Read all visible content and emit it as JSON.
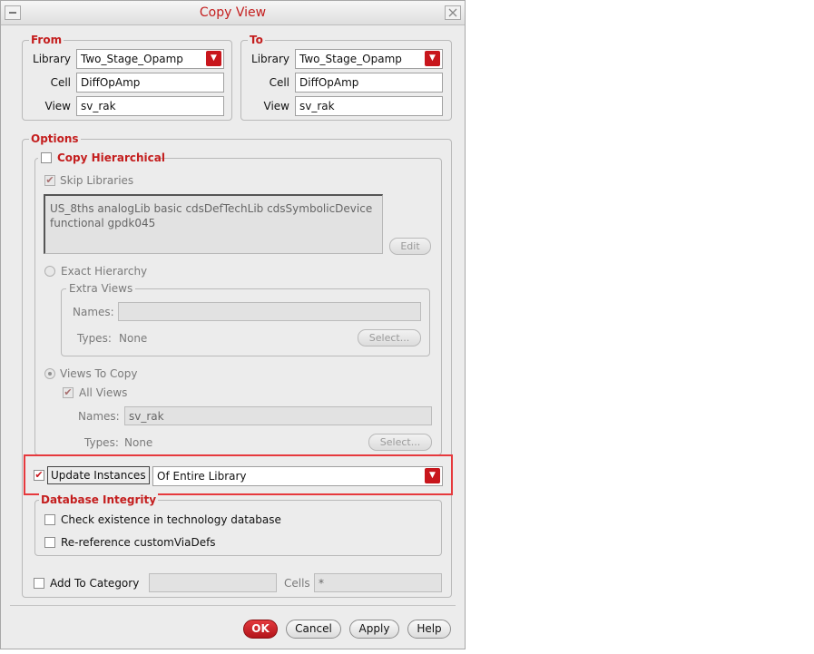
{
  "window": {
    "title": "Copy View"
  },
  "from": {
    "label": "From",
    "library_label": "Library",
    "library_value": "Two_Stage_Opamp",
    "cell_label": "Cell",
    "cell_value": "DiffOpAmp",
    "view_label": "View",
    "view_value": "sv_rak"
  },
  "to": {
    "label": "To",
    "library_label": "Library",
    "library_value": "Two_Stage_Opamp",
    "cell_label": "Cell",
    "cell_value": "DiffOpAmp",
    "view_label": "View",
    "view_value": "sv_rak"
  },
  "options": {
    "label": "Options",
    "copy_hierarchical": {
      "label": "Copy Hierarchical",
      "checked": false
    },
    "skip_libraries": {
      "label": "Skip Libraries",
      "checked": true
    },
    "skip_list_text": "US_8ths analogLib basic cdsDefTechLib cdsSymbolicDevice functional gpdk045",
    "edit_button": "Edit",
    "exact_hierarchy": "Exact Hierarchy",
    "extra_views": {
      "label": "Extra Views",
      "names_label": "Names:",
      "names_value": "",
      "types_label": "Types:",
      "types_value": "None",
      "select_button": "Select..."
    },
    "views_to_copy": {
      "label": "Views To Copy",
      "all_views_label": "All Views",
      "names_label": "Names:",
      "names_value": "sv_rak",
      "types_label": "Types:",
      "types_value": "None",
      "select_button": "Select..."
    },
    "update_instances": {
      "label": "Update Instances",
      "checked": true,
      "value": "Of Entire Library"
    },
    "database_integrity": {
      "label": "Database Integrity",
      "check_existence": "Check existence in technology database",
      "rereference": "Re-reference customViaDefs"
    },
    "add_to_category": {
      "label": "Add To Category",
      "category_value": "",
      "cells_label": "Cells",
      "cells_value": "*"
    }
  },
  "buttons": {
    "ok": "OK",
    "cancel": "Cancel",
    "apply": "Apply",
    "help": "Help"
  },
  "colors": {
    "accent": "#c41e1e",
    "highlight": "#e6393d",
    "ok_button": "#c8161c"
  }
}
